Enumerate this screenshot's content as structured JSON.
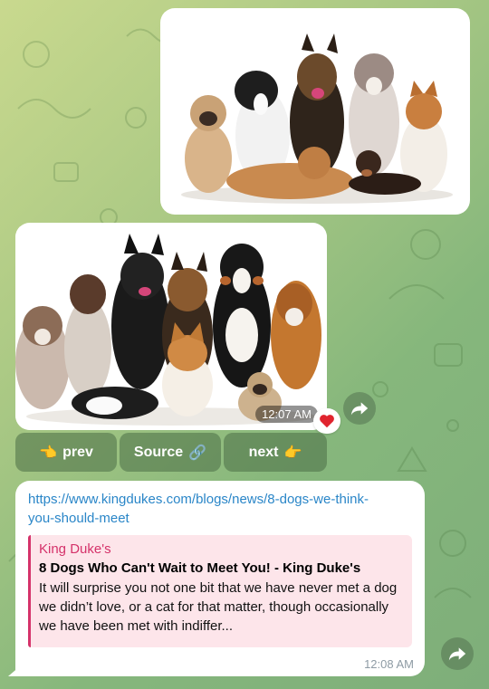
{
  "messages": [
    {
      "type": "photo",
      "subject": "group of dogs",
      "time": ""
    },
    {
      "type": "photo",
      "subject": "group of dogs",
      "time": "12:07 AM",
      "reaction": "heart"
    },
    {
      "type": "link",
      "url": "https://www.kingdukes.com/blogs/news/8-dogs-we-think-you-should-meet",
      "preview": {
        "site": "King Duke's",
        "title": "8 Dogs Who Can't Wait to Meet You! - King Duke's",
        "description": "It will surprise you not one bit that we have never met a dog we didn’t love, or a cat for that matter, though occasionally we have been met with indiffer..."
      },
      "time": "12:08 AM"
    }
  ],
  "keyboard": {
    "prev": {
      "emoji": "👈",
      "label": "prev"
    },
    "source": {
      "label": "Source",
      "emoji": "🔗"
    },
    "next": {
      "label": "next",
      "emoji": "👉"
    }
  },
  "colors": {
    "link": "#2a86c8",
    "preview_accent": "#d5326a",
    "preview_bg": "#fde5ea",
    "reaction": "#e0242e"
  },
  "icons": {
    "forward": "forward-arrow-icon",
    "reaction": "heart-icon"
  }
}
